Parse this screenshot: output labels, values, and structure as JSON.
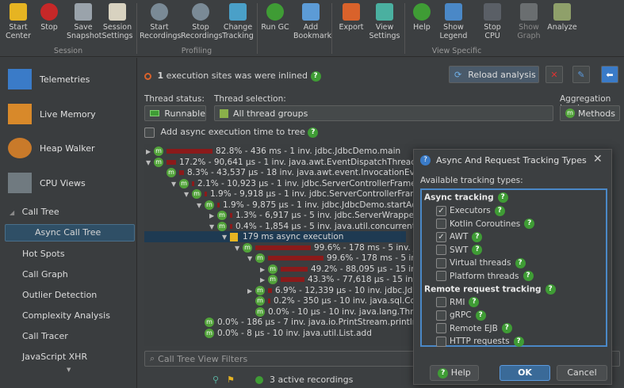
{
  "toolbar": {
    "buttons": [
      {
        "label": "Start\nCenter",
        "icon": "start-center-icon"
      },
      {
        "label": "Stop",
        "icon": "stop-icon"
      },
      {
        "label": "Save\nSnapshot",
        "icon": "save-icon"
      },
      {
        "label": "Session\nSettings",
        "icon": "session-settings-icon"
      },
      {
        "label": "Start\nRecordings",
        "icon": "start-recordings-icon"
      },
      {
        "label": "Stop\nRecordings",
        "icon": "stop-recordings-icon"
      },
      {
        "label": "Change\nTracking",
        "icon": "change-tracking-icon"
      },
      {
        "label": "Run GC",
        "icon": "run-gc-icon"
      },
      {
        "label": "Add\nBookmark",
        "icon": "add-bookmark-icon"
      },
      {
        "label": "Export",
        "icon": "export-icon"
      },
      {
        "label": "View\nSettings",
        "icon": "view-settings-icon"
      },
      {
        "label": "Help",
        "icon": "help-icon"
      },
      {
        "label": "Show\nLegend",
        "icon": "show-legend-icon"
      },
      {
        "label": "Stop\nCPU",
        "icon": "stop-cpu-icon"
      },
      {
        "label": "Show\nGraph",
        "icon": "show-graph-icon"
      },
      {
        "label": "Analyze",
        "icon": "analyze-icon"
      }
    ],
    "groups": {
      "session": "Session",
      "profiling": "Profiling",
      "view_specific": "View Specific"
    }
  },
  "sidebar": {
    "big_items": [
      {
        "label": "Telemetries",
        "icon": "telemetries-icon"
      },
      {
        "label": "Live Memory",
        "icon": "live-memory-icon"
      },
      {
        "label": "Heap Walker",
        "icon": "heap-walker-icon"
      },
      {
        "label": "CPU Views",
        "icon": "cpu-views-icon"
      }
    ],
    "call_tree": "Call Tree",
    "selected": "Async Call Tree",
    "items": [
      "Hot Spots",
      "Call Graph",
      "Outlier Detection",
      "Complexity Analysis",
      "Call Tracer",
      "JavaScript XHR"
    ]
  },
  "main": {
    "info_count": "1",
    "info_text": "execution sites was were inlined",
    "reload_label": "Reload analysis",
    "thread_status_label": "Thread status:",
    "thread_status_value": "Runnable",
    "thread_selection_label": "Thread selection:",
    "thread_selection_value": "All thread groups",
    "aggregation_label": "Aggregation level:",
    "aggregation_value": "Methods",
    "async_checkbox_label": "Add async execution time to tree",
    "filter_placeholder": "Call Tree View Filters",
    "tree": [
      "82.8% - 436 ms - 1 inv. jdbc.JdbcDemo.main",
      "17.2% - 90,641 µs - 1 inv. java.awt.EventDispatchThread.run",
      "8.3% - 43,537 µs - 18 inv. java.awt.event.InvocationEvent.dispa",
      "2.1% - 10,923 µs - 1 inv. jdbc.ServerControllerFrame$2.window",
      "1.9% - 9,918 µs - 1 inv. jdbc.ServerControllerFrame.updateA",
      "1.9% - 9,875 µs - 1 inv. jdbc.JdbcDemo.startActivity",
      "1.3% - 6,917 µs - 5 inv. jdbc.ServerWrapper.getDataS",
      "0.4% - 1,854 µs - 5 inv. java.util.concurrent.ExecutorS",
      "179 ms async execution",
      "99.6% - 178 ms - 5 inv. jdbc.JdbcTes",
      "99.6% - 178 ms - 5 inv. jdbc.Jdbc",
      "49.2% - 88,095 µs - 15 inv. javax.s",
      "43.3% - 77,618 µs - 15 inv. jdbc.Jdl",
      "6.9% - 12,339 µs - 10 inv. jdbc.JdbcTes",
      "0.2% - 350 µs - 10 inv. java.sql.Connec",
      "0.0% - 10 µs - 10 inv. java.lang.Thread.",
      "0.0% - 186 µs - 7 inv. java.io.PrintStream.println",
      "0.0% - 8 µs - 10 inv. java.util.List.add"
    ],
    "tree_fractions": [
      0.828,
      0.172,
      0.083,
      0.021,
      0.019,
      0.019,
      0.013,
      0.004,
      0,
      0.996,
      0.996,
      0.492,
      0.433,
      0.069,
      0.002,
      0,
      0,
      0
    ]
  },
  "dialog": {
    "title": "Async And Request Tracking Types",
    "available": "Available tracking types:",
    "async_header": "Async tracking",
    "async_options": [
      {
        "label": "Executors",
        "checked": true
      },
      {
        "label": "Kotlin Coroutines",
        "checked": false
      },
      {
        "label": "AWT",
        "checked": true
      },
      {
        "label": "SWT",
        "checked": false
      },
      {
        "label": "Virtual threads",
        "checked": false
      },
      {
        "label": "Platform threads",
        "checked": false
      }
    ],
    "remote_header": "Remote request tracking",
    "remote_options": [
      {
        "label": "RMI",
        "checked": false
      },
      {
        "label": "gRPC",
        "checked": false
      },
      {
        "label": "Remote EJB",
        "checked": false
      },
      {
        "label": "HTTP requests",
        "checked": false
      }
    ],
    "help": "Help",
    "ok": "OK",
    "cancel": "Cancel"
  },
  "status": {
    "recordings": "3 active recordings"
  },
  "colors": {
    "accent": "#3f9c35",
    "selection": "#2f4f66",
    "bar": "#8b1a1a",
    "focus": "#4a88c7"
  }
}
